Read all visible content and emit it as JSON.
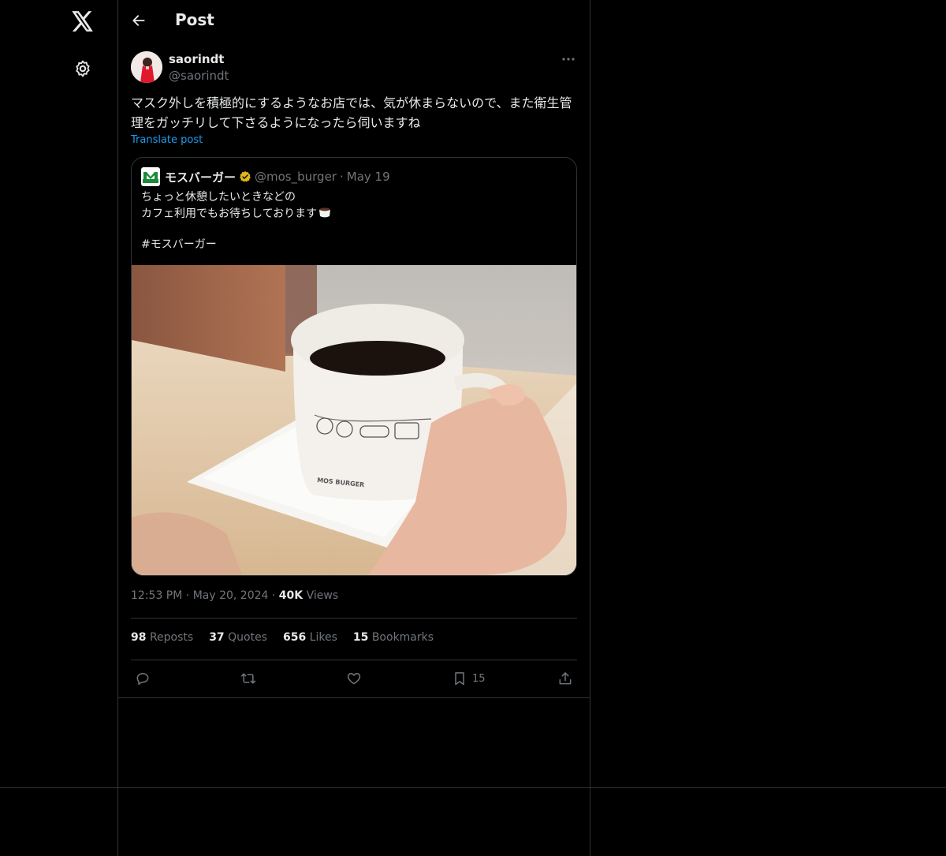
{
  "header": {
    "title": "Post"
  },
  "post": {
    "author_name": "saorindt",
    "author_handle": "@saorindt",
    "text": "マスク外しを積極的にするようなお店では、気が休まらないので、また衛生管理をガッチリして下さるようになったら伺いますね",
    "translate_label": "Translate post",
    "time": "12:53 PM",
    "date": "May 20, 2024",
    "views_count": "40K",
    "views_label": "Views"
  },
  "quote": {
    "name": "モスバーガー",
    "handle": "@mos_burger",
    "date": "May 19",
    "lines": [
      "ちょっと休憩したいときなどの",
      "カフェ利用でもお待ちしております",
      "",
      "#モスバーガー"
    ],
    "cup_text": "MOS BURGER"
  },
  "stats": [
    {
      "count": "98",
      "label": "Reposts"
    },
    {
      "count": "37",
      "label": "Quotes"
    },
    {
      "count": "656",
      "label": "Likes"
    },
    {
      "count": "15",
      "label": "Bookmarks"
    }
  ],
  "actions": {
    "bookmark_count": "15"
  },
  "icons": {
    "logo": "x-logo-icon",
    "settings": "gear-icon",
    "back": "arrow-left-icon",
    "more": "more-horizontal-icon",
    "verified": "verified-badge-icon",
    "reply": "reply-icon",
    "repost": "repost-icon",
    "like": "heart-icon",
    "bookmark": "bookmark-icon",
    "share": "share-icon"
  },
  "colors": {
    "background": "#000000",
    "text": "#e7e9ea",
    "muted": "#71767b",
    "link": "#1d9bf0",
    "border": "#2f3336",
    "verified": "#e2b719",
    "brand_green": "#1b8a3b"
  }
}
